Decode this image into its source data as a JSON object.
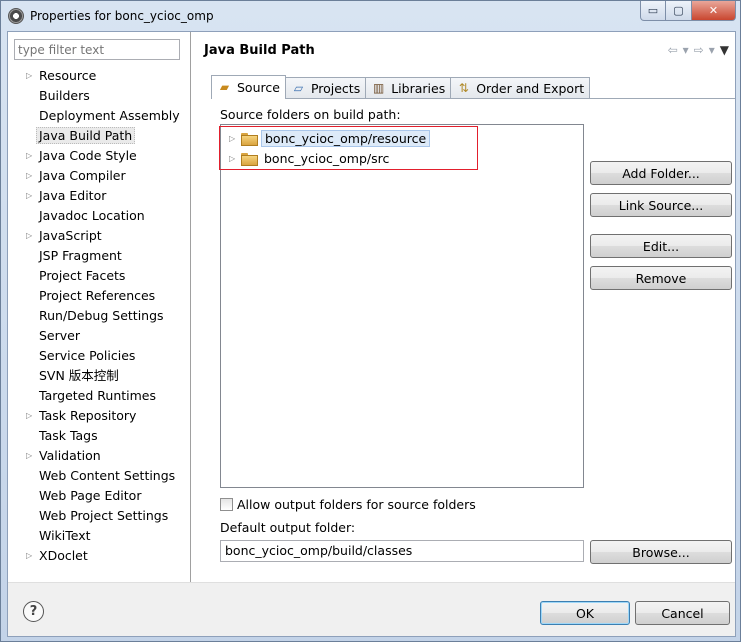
{
  "window": {
    "title": "Properties for bonc_ycioc_omp",
    "icon": "eclipse-properties-icon",
    "controls": {
      "minimize": "▭",
      "maximize": "▢",
      "close": "✕"
    }
  },
  "filter": {
    "placeholder": "type filter text"
  },
  "nav": {
    "selected": "Java Build Path",
    "items": [
      {
        "label": "Resource",
        "expandable": true
      },
      {
        "label": "Builders",
        "expandable": false
      },
      {
        "label": "Deployment Assembly",
        "expandable": false
      },
      {
        "label": "Java Build Path",
        "expandable": false
      },
      {
        "label": "Java Code Style",
        "expandable": true
      },
      {
        "label": "Java Compiler",
        "expandable": true
      },
      {
        "label": "Java Editor",
        "expandable": true
      },
      {
        "label": "Javadoc Location",
        "expandable": false
      },
      {
        "label": "JavaScript",
        "expandable": true
      },
      {
        "label": "JSP Fragment",
        "expandable": false
      },
      {
        "label": "Project Facets",
        "expandable": false
      },
      {
        "label": "Project References",
        "expandable": false
      },
      {
        "label": "Run/Debug Settings",
        "expandable": false
      },
      {
        "label": "Server",
        "expandable": false
      },
      {
        "label": "Service Policies",
        "expandable": false
      },
      {
        "label": "SVN 版本控制",
        "expandable": false
      },
      {
        "label": "Targeted Runtimes",
        "expandable": false
      },
      {
        "label": "Task Repository",
        "expandable": true
      },
      {
        "label": "Task Tags",
        "expandable": false
      },
      {
        "label": "Validation",
        "expandable": true
      },
      {
        "label": "Web Content Settings",
        "expandable": false
      },
      {
        "label": "Web Page Editor",
        "expandable": false
      },
      {
        "label": "Web Project Settings",
        "expandable": false
      },
      {
        "label": "WikiText",
        "expandable": false
      },
      {
        "label": "XDoclet",
        "expandable": true
      }
    ]
  },
  "page": {
    "title": "Java Build Path",
    "nav_icons": [
      "back-arrow-icon",
      "dropdown-icon",
      "forward-arrow-icon",
      "dropdown-icon",
      "view-menu-icon"
    ]
  },
  "tabs": [
    {
      "label": "Source",
      "icon": "source-folder-icon",
      "active": true
    },
    {
      "label": "Projects",
      "icon": "projects-icon",
      "active": false
    },
    {
      "label": "Libraries",
      "icon": "libraries-icon",
      "active": false
    },
    {
      "label": "Order and Export",
      "icon": "order-export-icon",
      "active": false
    }
  ],
  "source": {
    "label": "Source folders on build path:",
    "folders": [
      {
        "label": "bonc_ycioc_omp/resource",
        "selected": true
      },
      {
        "label": "bonc_ycioc_omp/src",
        "selected": false
      }
    ],
    "highlight_color": "#e21f2d",
    "buttons": {
      "add_folder": "Add Folder...",
      "link_source": "Link Source...",
      "edit": "Edit...",
      "remove": "Remove"
    },
    "allow_output_label": "Allow output folders for source folders",
    "allow_output_checked": false,
    "default_output_label": "Default output folder:",
    "default_output_value": "bonc_ycioc_omp/build/classes",
    "browse": "Browse..."
  },
  "footer": {
    "help": "?",
    "ok": "OK",
    "cancel": "Cancel"
  }
}
